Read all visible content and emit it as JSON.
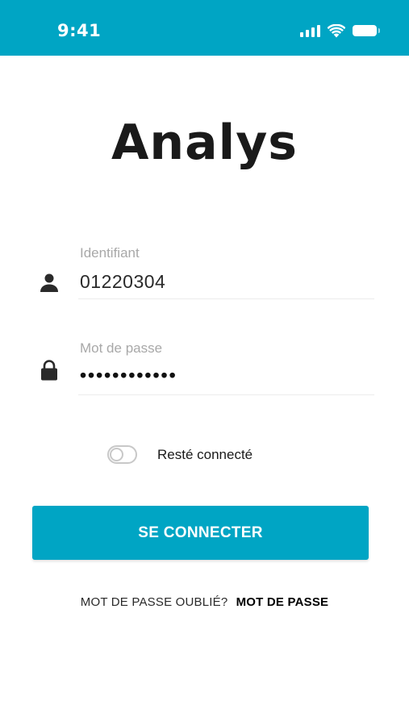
{
  "status_bar": {
    "time": "9:41",
    "color": "#00a5c4",
    "icons": [
      "signal-icon",
      "wifi-icon",
      "battery-icon"
    ]
  },
  "logo": {
    "text": "Analys"
  },
  "form": {
    "username": {
      "label": "Identifiant",
      "value": "01220304",
      "icon": "user-icon"
    },
    "password": {
      "label": "Mot de passe",
      "value": "••••••••••••",
      "icon": "lock-icon"
    },
    "remember": {
      "label": "Resté connecté",
      "checked": false
    }
  },
  "login_button": {
    "label": "SE CONNECTER",
    "color": "#00a5c4"
  },
  "forgot": {
    "question": "MOT DE PASSE OUBLIÉ?",
    "link": "MOT DE PASSE"
  }
}
